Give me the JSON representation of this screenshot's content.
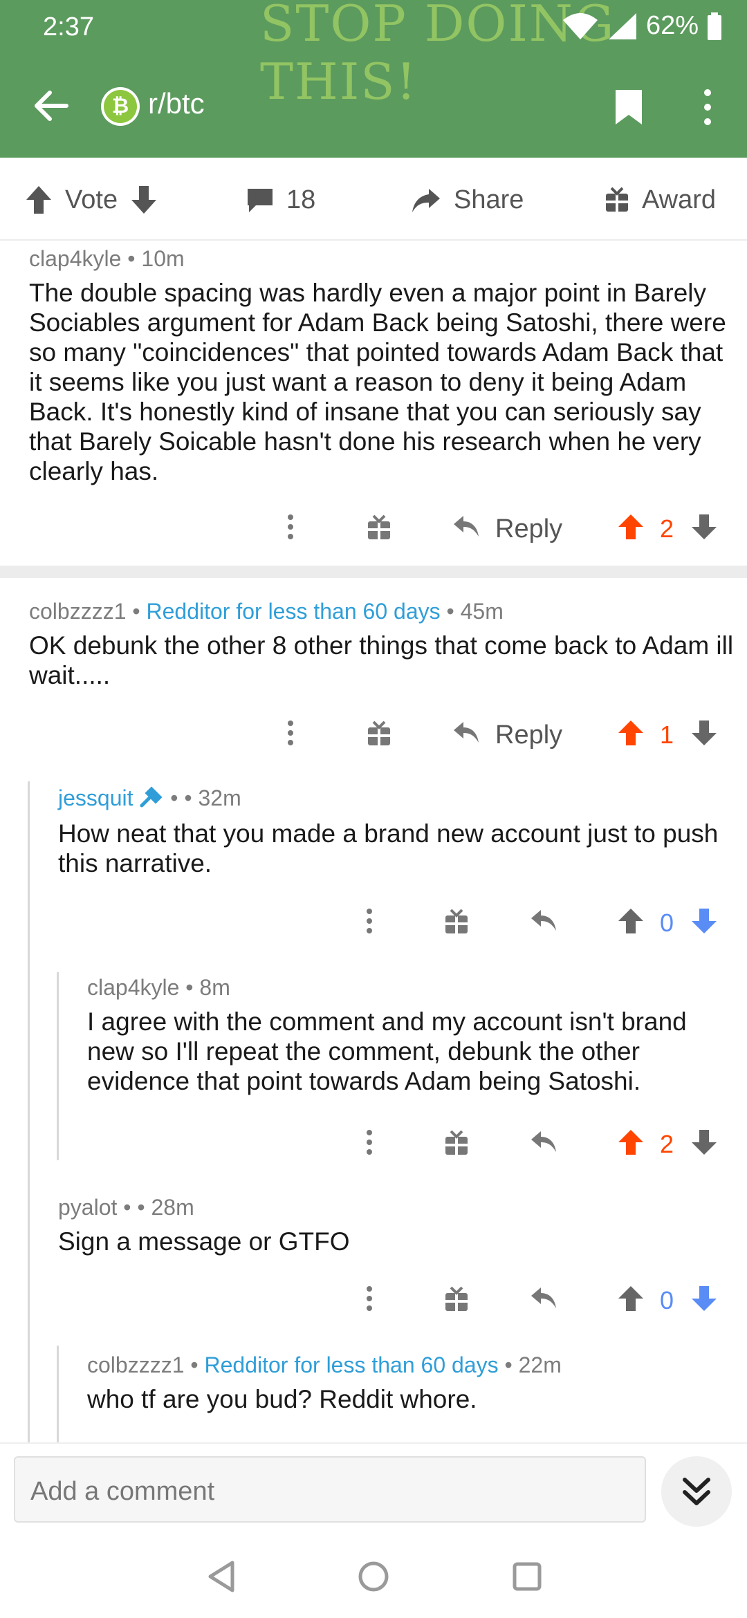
{
  "status": {
    "time": "2:37",
    "watermark": "STOP DOING THIS!",
    "battery": "62%"
  },
  "header": {
    "subreddit": "r/btc",
    "icon": "bitcoin-cash-icon"
  },
  "actions": {
    "vote": "Vote",
    "comments": "18",
    "share": "Share",
    "award": "Award"
  },
  "comments": [
    {
      "author": "clap4kyle",
      "flair": "",
      "time": "10m",
      "body": "The double spacing was hardly even a major point in Barely Sociables argument for Adam Back being Satoshi, there were so many \"coincidences\" that pointed towards Adam Back that it seems like you just want a reason to deny it being Adam Back. It's honestly kind of insane that you can seriously say that Barely Soicable hasn't done his research when he very clearly has.",
      "reply": "Reply",
      "score": "2"
    },
    {
      "author": "colbzzzz1",
      "flair": "Redditor for less than 60 days",
      "time": "45m",
      "body": "OK debunk the other 8 other things that come back to Adam ill wait.....",
      "reply": "Reply",
      "score": "1"
    },
    {
      "author": "jessquit",
      "flair": "",
      "time": "32m",
      "body": "How neat that you made a brand new account just to push this narrative.",
      "score": "0"
    },
    {
      "author": "clap4kyle",
      "flair": "",
      "time": "8m",
      "body": "I agree with the comment and my account isn't brand new so I'll repeat the comment, debunk the other evidence that point towards Adam being Satoshi.",
      "score": "2"
    },
    {
      "author": "pyalot",
      "flair": "",
      "time": "28m",
      "body": "Sign a message or GTFO",
      "score": "0"
    },
    {
      "author": "colbzzzz1",
      "flair": "Redditor for less than 60 days",
      "time": "22m",
      "body": "who tf are you bud? Reddit whore."
    }
  ],
  "composer": {
    "placeholder": "Add a comment"
  },
  "colors": {
    "header": "#5c9b5e",
    "upvote": "#ff4500",
    "downvote": "#5a8cf5",
    "flair": "#2f9ed8"
  }
}
